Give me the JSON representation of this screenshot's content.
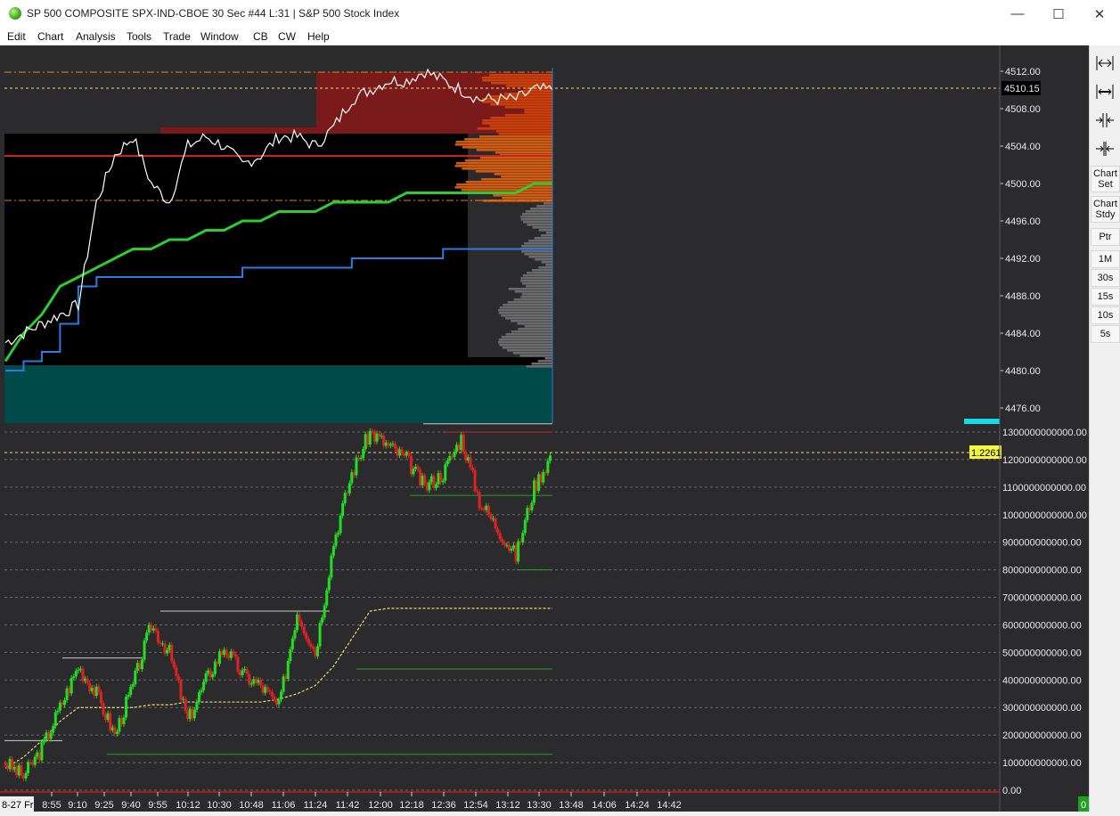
{
  "window": {
    "title": "SP 500 COMPOSITE SPX-IND-CBOE  30 Sec   #44 L:31 | S&P 500 Stock Index",
    "minimize": "—",
    "maximize": "☐",
    "close": "✕"
  },
  "menu": {
    "items": [
      "Edit",
      "Chart",
      "Analysis",
      "Tools",
      "Trade",
      "Window",
      "CB",
      "CW",
      "Help"
    ]
  },
  "price_panel": {
    "y_ticks": [
      "4512.00",
      "4508.00",
      "4504.00",
      "4500.00",
      "4496.00",
      "4492.00",
      "4488.00",
      "4484.00",
      "4480.00",
      "4476.00"
    ],
    "last_price": "4510.15"
  },
  "lower_panel": {
    "y_ticks": [
      "1300000000000.00",
      "1200000000000.00",
      "1100000000000.00",
      "1000000000000.00",
      "900000000000.00",
      "800000000000.00",
      "700000000000.00",
      "600000000000.00",
      "500000000000.00",
      "400000000000.00",
      "300000000000.00",
      "200000000000.00",
      "100000000000.00",
      "0.00"
    ],
    "last_value": "1.2261"
  },
  "x_axis": {
    "start_label": "8-27 Fr",
    "ticks": [
      "8:55",
      "9:10",
      "9:25",
      "9:40",
      "9:55",
      "10:12",
      "10:30",
      "10:48",
      "11:06",
      "11:24",
      "11:42",
      "12:00",
      "12:18",
      "12:36",
      "12:54",
      "13:12",
      "13:30",
      "13:48",
      "14:06",
      "14:24",
      "14:42"
    ]
  },
  "toolbar": {
    "chart_set": [
      "Chart",
      "Set"
    ],
    "chart_study": [
      "Chart",
      "Stdy"
    ],
    "pointer": "Ptr",
    "timeframes": [
      "1M",
      "30s",
      "15s",
      "10s",
      "5s"
    ]
  },
  "status": {
    "indicator": "0"
  },
  "colors": {
    "background": "#2b2b2e",
    "price_line": "#ffffff",
    "vwap": "#2ecc2e",
    "blue_line": "#2a7de1",
    "profile_red": "#7a1a1a",
    "profile_orange": "#cc4a0a",
    "teal_zone": "#004a4a",
    "last_price_line": "#e8e06a",
    "up_candle": "#22dd22",
    "down_candle": "#dd2222"
  },
  "chart_data": {
    "type": "line",
    "series": [
      {
        "values": [
          4483,
          4484,
          4485,
          4486,
          4487,
          4498,
          4503,
          4505,
          4500,
          4498,
          4504,
          4505,
          4504,
          4502,
          4503,
          4505,
          4505,
          4504,
          4506,
          4509,
          4510,
          4511,
          4511,
          4512,
          4511,
          4510,
          4509,
          4509,
          4509,
          4510,
          4510
        ]
      },
      {
        "values": [
          4481,
          4484,
          4486,
          4489,
          4490,
          4491,
          4492,
          4493,
          4493,
          4494,
          4494,
          4495,
          4495,
          4496,
          4496,
          4497,
          4497,
          4497,
          4498,
          4498,
          4498,
          4498,
          4499,
          4499,
          4499,
          4499,
          4499,
          4499,
          4499,
          4500,
          4500
        ]
      },
      {
        "values": [
          4480,
          4481,
          4482,
          4485,
          4489,
          4490,
          4490,
          4490,
          4490,
          4490,
          4490,
          4490,
          4490,
          4491,
          4491,
          4491,
          4491,
          4491,
          4491,
          4492,
          4492,
          4492,
          4492,
          4492,
          4493,
          4493,
          4493,
          4493,
          4493,
          4493,
          4493
        ]
      }
    ],
    "lower_values": [
      100000000000,
      50000000000,
      150000000000,
      300000000000,
      450000000000,
      350000000000,
      200000000000,
      380000000000,
      600000000000,
      500000000000,
      250000000000,
      400000000000,
      520000000000,
      420000000000,
      380000000000,
      300000000000,
      650000000000,
      500000000000,
      900000000000,
      1150000000000,
      1300000000000,
      1250000000000,
      1200000000000,
      1100000000000,
      1150000000000,
      1280000000000,
      1050000000000,
      950000000000,
      850000000000,
      1100000000000,
      1226100000000
    ],
    "ylim_upper": [
      4474,
      4513.5
    ],
    "ylim_lower": [
      0,
      1330000000000
    ]
  }
}
